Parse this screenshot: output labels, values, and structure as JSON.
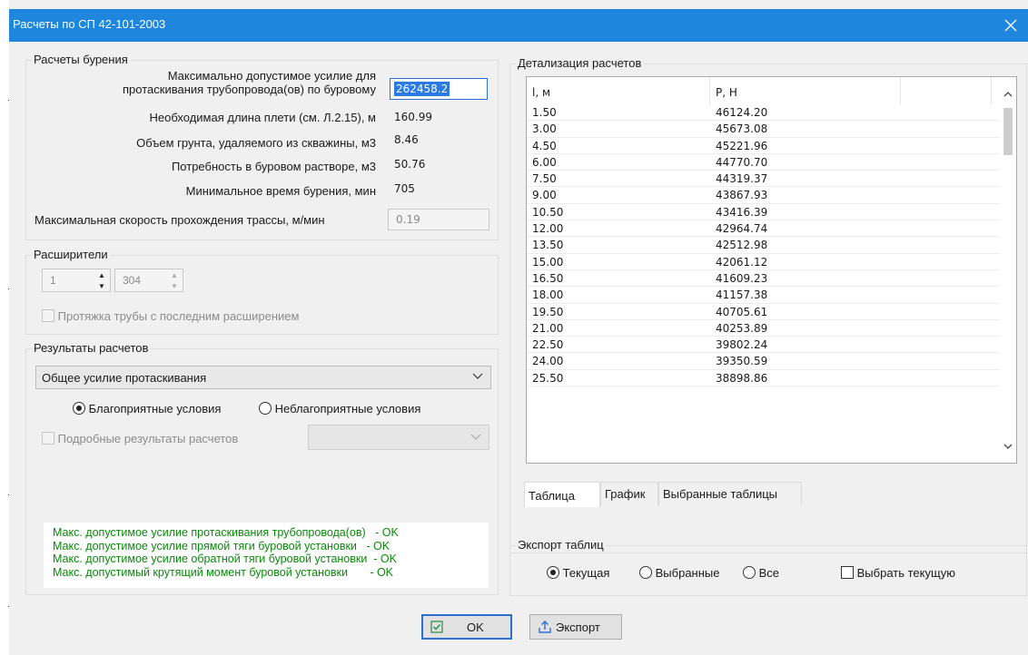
{
  "window": {
    "title": "Расчеты по СП 42-101-2003",
    "close_glyph": "✕"
  },
  "drilling": {
    "legend": "Расчеты бурения",
    "max_force_label_line1": "Максимально допустимое усилие для",
    "max_force_label_line2": "протаскивания трубопровода(ов) по буровому",
    "max_force_value": "262458.2",
    "length_label": "Необходимая длина плети (см. Л.2.15), м",
    "length_value": "160.99",
    "soil_label": "Объем грунта, удаляемого из скважины, м3",
    "soil_value": "8.46",
    "fluid_label": "Потребность в буровом растворе, м3",
    "fluid_value": "50.76",
    "time_label": "Минимальное время бурения, мин",
    "time_value": "705",
    "speed_label": "Максимальная скорость прохождения трассы, м/мин",
    "speed_value": "0.19"
  },
  "reamers": {
    "legend": "Расширители",
    "count_value": "1",
    "size_value": "304",
    "pull_label": "Протяжка трубы с последним расширением"
  },
  "results": {
    "legend": "Результаты расчетов",
    "combo_value": "Общее усилие протаскивания",
    "radio_favorable": "Благоприятные условия",
    "radio_unfavorable": "Неблагоприятные условия",
    "detailed_label": "Подробные результаты расчетов",
    "status_lines": [
      "Макс. допустимое усилие протаскивания трубопровода(ов)   - OK",
      "Макс. допустимое усилие прямой тяги буровой установки   - OK",
      "Макс. допустимое усилие обратной тяги буровой установки  - OK",
      "Макс. допустимый крутящий момент буровой установки       - OK"
    ]
  },
  "details": {
    "legend": "Детализация расчетов",
    "col_l": "l, м",
    "col_p": "P, Н",
    "rows": [
      [
        "1.50",
        "46124.20"
      ],
      [
        "3.00",
        "45673.08"
      ],
      [
        "4.50",
        "45221.96"
      ],
      [
        "6.00",
        "44770.70"
      ],
      [
        "7.50",
        "44319.37"
      ],
      [
        "9.00",
        "43867.93"
      ],
      [
        "10.50",
        "43416.39"
      ],
      [
        "12.00",
        "42964.74"
      ],
      [
        "13.50",
        "42512.98"
      ],
      [
        "15.00",
        "42061.12"
      ],
      [
        "16.50",
        "41609.23"
      ],
      [
        "18.00",
        "41157.38"
      ],
      [
        "19.50",
        "40705.61"
      ],
      [
        "21.00",
        "40253.89"
      ],
      [
        "22.50",
        "39802.24"
      ],
      [
        "24.00",
        "39350.59"
      ],
      [
        "25.50",
        "38898.86"
      ]
    ],
    "tabs": [
      "Таблица",
      "График",
      "Выбранные таблицы"
    ]
  },
  "export": {
    "legend": "Экспорт таблиц",
    "radio_current": "Текущая",
    "radio_selected": "Выбранные",
    "radio_all": "Все",
    "choose_current": "Выбрать текущую"
  },
  "buttons": {
    "ok": "OK",
    "export": "Экспорт"
  },
  "colors": {
    "titlebar": "#1e86dc",
    "status_ok": "#0a8a0a",
    "selection": "#2c7be5"
  }
}
